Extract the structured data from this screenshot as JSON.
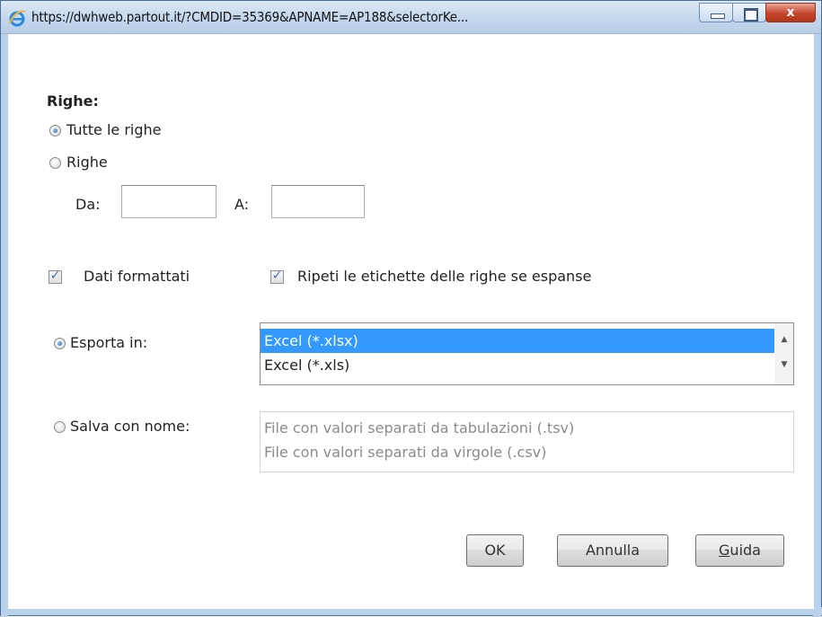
{
  "window": {
    "title": "https://dwhweb.partout.it/?CMDID=35369&APNAME=AP188&selectorKe...",
    "close_symbol": "x"
  },
  "righe": {
    "heading": "Righe:",
    "option_all": "Tutte le righe",
    "option_range": "Righe",
    "from_label": "Da:",
    "from_value": "",
    "to_label": "A:",
    "to_value": ""
  },
  "options": {
    "formatted": {
      "label": "Dati formattati",
      "checked": true
    },
    "repeat_labels": {
      "label": "Ripeti le etichette delle righe se espanse",
      "checked": true
    }
  },
  "export": {
    "label": "Esporta in:",
    "selected": true,
    "formats": [
      "Excel (*.xlsx)",
      "Excel (*.xls)"
    ],
    "selected_format": "Excel (*.xlsx)"
  },
  "save_as": {
    "label": "Salva con nome:",
    "selected": false,
    "formats": [
      "File con valori separati da tabulazioni (.tsv)",
      "File con valori separati da virgole (.csv)"
    ]
  },
  "buttons": {
    "ok": "OK",
    "cancel": "Annulla",
    "help_accel": "G",
    "help_rest": "uida"
  },
  "icons": {
    "title_icon": "internet-explorer-icon",
    "minimize": "minimize-icon",
    "maximize": "maximize-icon",
    "close": "close-icon",
    "radio_checked": "radio-checked-icon",
    "checkbox_checked": "checkmark-icon",
    "scroll_up": "scroll-up-arrow-icon",
    "scroll_down": "scroll-down-arrow-icon"
  },
  "colors": {
    "selection": "#3399ff",
    "titlebar": "#c4d7ee",
    "close_button": "#c7452c"
  }
}
